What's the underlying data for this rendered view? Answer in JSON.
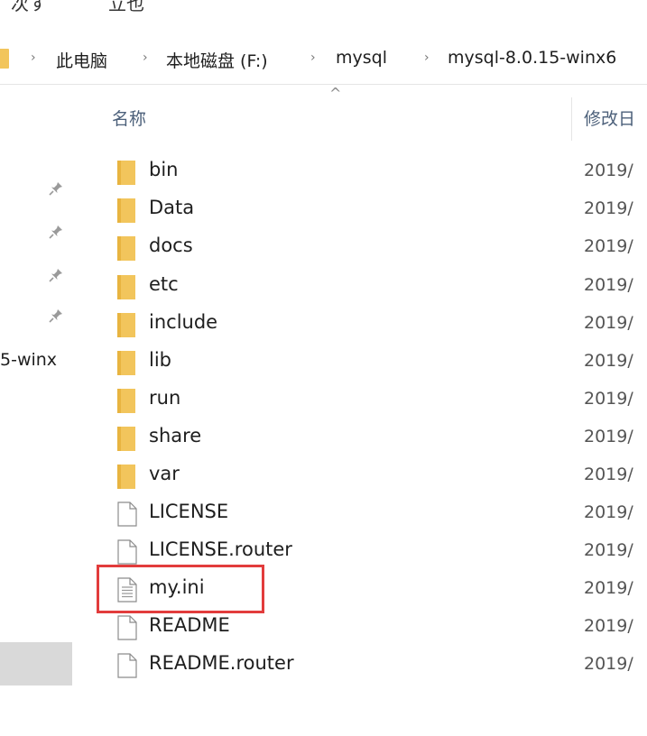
{
  "top_strip": {
    "text_left": "次す",
    "text_right": "立也"
  },
  "breadcrumb": {
    "items": [
      "此电脑",
      "本地磁盘 (F:)",
      "mysql",
      "mysql-8.0.15-winx6"
    ],
    "separator": "›"
  },
  "columns": {
    "sort_indicator": "^",
    "name": "名称",
    "date_modified": "修改日"
  },
  "nav_pane": {
    "truncated_label": "5-winx"
  },
  "files": [
    {
      "name": "bin",
      "date": "2019/",
      "type": "folder"
    },
    {
      "name": "Data",
      "date": "2019/",
      "type": "folder"
    },
    {
      "name": "docs",
      "date": "2019/",
      "type": "folder"
    },
    {
      "name": "etc",
      "date": "2019/",
      "type": "folder"
    },
    {
      "name": "include",
      "date": "2019/",
      "type": "folder"
    },
    {
      "name": "lib",
      "date": "2019/",
      "type": "folder"
    },
    {
      "name": "run",
      "date": "2019/",
      "type": "folder"
    },
    {
      "name": "share",
      "date": "2019/",
      "type": "folder"
    },
    {
      "name": "var",
      "date": "2019/",
      "type": "folder"
    },
    {
      "name": "LICENSE",
      "date": "2019/",
      "type": "file"
    },
    {
      "name": "LICENSE.router",
      "date": "2019/",
      "type": "file"
    },
    {
      "name": "my.ini",
      "date": "2019/",
      "type": "config-file"
    },
    {
      "name": "README",
      "date": "2019/",
      "type": "file"
    },
    {
      "name": "README.router",
      "date": "2019/",
      "type": "file"
    }
  ],
  "colors": {
    "folder": "#f2c55c",
    "highlight": "#e23c3c",
    "header_text": "#4c607a"
  }
}
